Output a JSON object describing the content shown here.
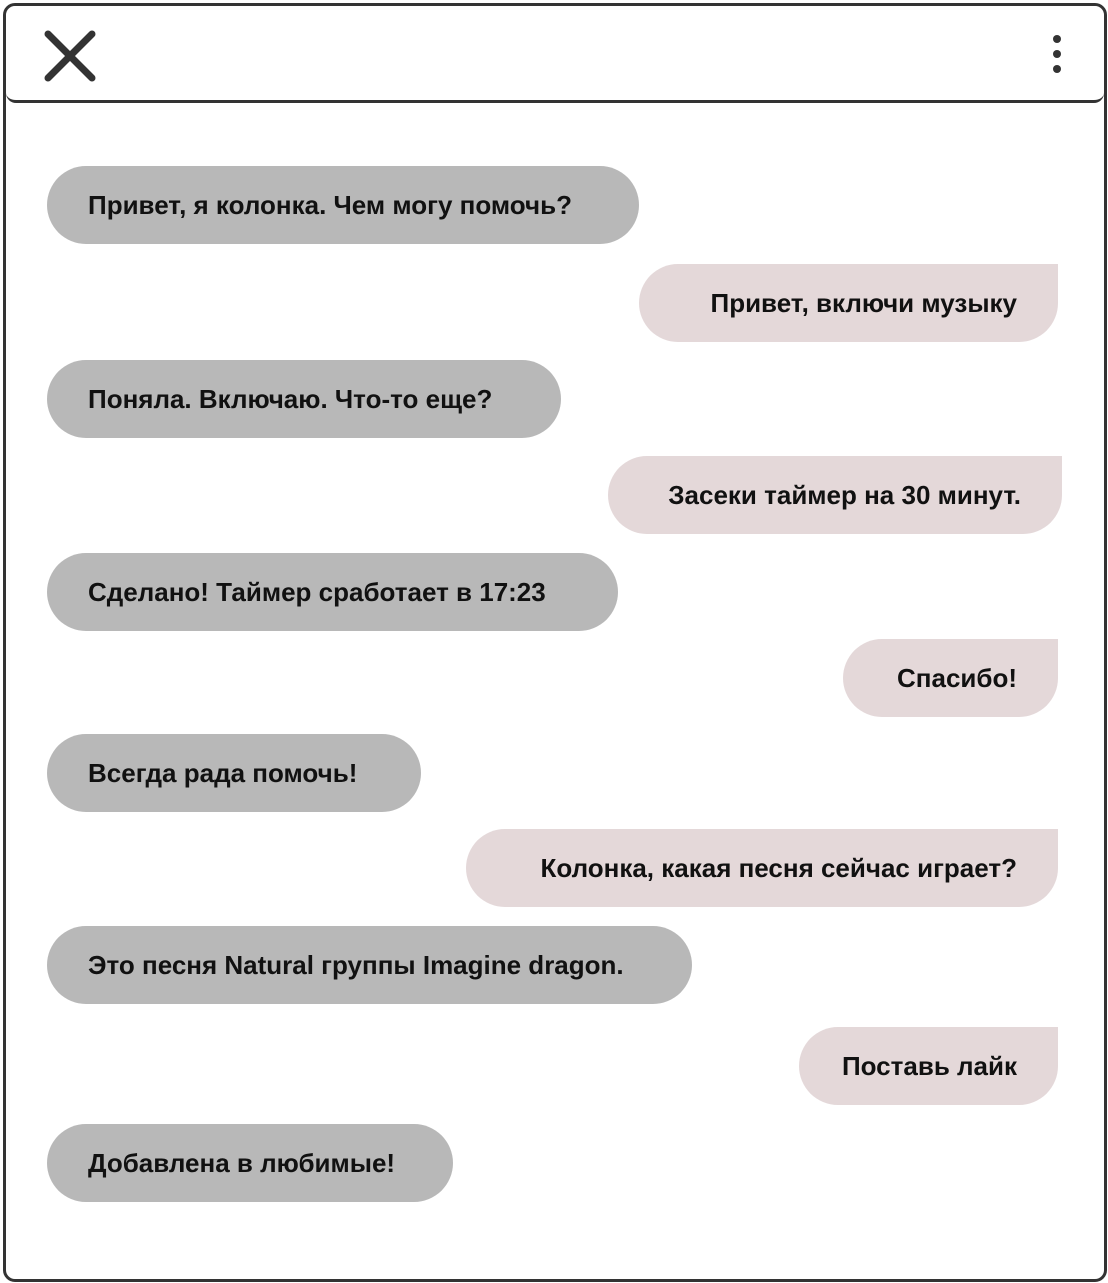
{
  "messages": [
    {
      "from": "bot",
      "text": "Привет, я колонка. Чем могу помочь?"
    },
    {
      "from": "user",
      "text": "Привет, включи музыку"
    },
    {
      "from": "bot",
      "text": "Поняла. Включаю. Что-то еще?"
    },
    {
      "from": "user",
      "text": "Засеки таймер на 30 минут."
    },
    {
      "from": "bot",
      "text": "Сделано! Таймер сработает в 17:23"
    },
    {
      "from": "user",
      "text": "Спасибо!"
    },
    {
      "from": "bot",
      "text": "Всегда рада помочь!"
    },
    {
      "from": "user",
      "text": "Колонка, какая песня сейчас играет?"
    },
    {
      "from": "bot",
      "text": "Это песня Natural группы Imagine dragon."
    },
    {
      "from": "user",
      "text": "Поставь лайк"
    },
    {
      "from": "bot",
      "text": "Добавлена в любимые!"
    }
  ],
  "colors": {
    "bot_bubble": "#b8b8b8",
    "user_bubble": "#e4d8d9",
    "frame": "#333333",
    "text": "#111111"
  },
  "icons": {
    "close": "close-icon",
    "menu": "more-vertical-icon"
  }
}
